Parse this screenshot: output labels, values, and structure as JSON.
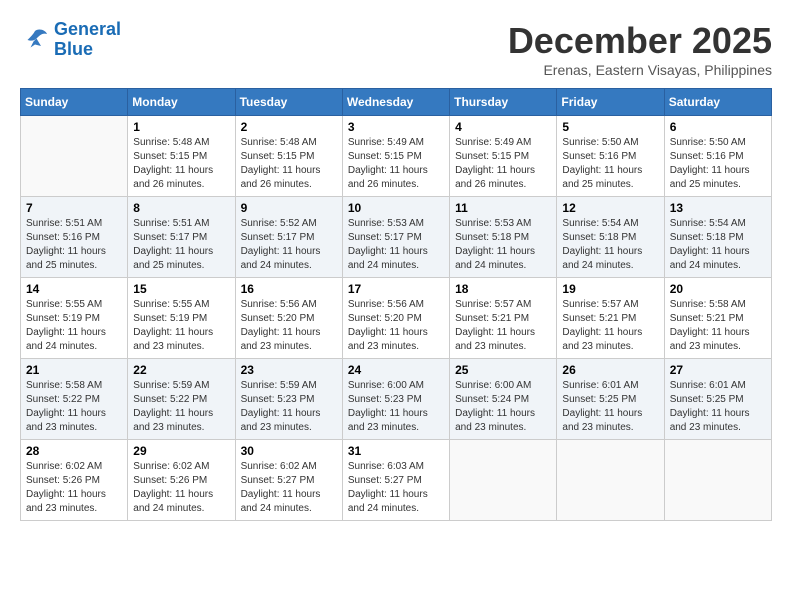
{
  "header": {
    "logo_line1": "General",
    "logo_line2": "Blue",
    "month": "December 2025",
    "location": "Erenas, Eastern Visayas, Philippines"
  },
  "days_of_week": [
    "Sunday",
    "Monday",
    "Tuesday",
    "Wednesday",
    "Thursday",
    "Friday",
    "Saturday"
  ],
  "weeks": [
    [
      {
        "day": "",
        "sunrise": "",
        "sunset": "",
        "daylight": "",
        "empty": true
      },
      {
        "day": "1",
        "sunrise": "Sunrise: 5:48 AM",
        "sunset": "Sunset: 5:15 PM",
        "daylight": "Daylight: 11 hours and 26 minutes."
      },
      {
        "day": "2",
        "sunrise": "Sunrise: 5:48 AM",
        "sunset": "Sunset: 5:15 PM",
        "daylight": "Daylight: 11 hours and 26 minutes."
      },
      {
        "day": "3",
        "sunrise": "Sunrise: 5:49 AM",
        "sunset": "Sunset: 5:15 PM",
        "daylight": "Daylight: 11 hours and 26 minutes."
      },
      {
        "day": "4",
        "sunrise": "Sunrise: 5:49 AM",
        "sunset": "Sunset: 5:15 PM",
        "daylight": "Daylight: 11 hours and 26 minutes."
      },
      {
        "day": "5",
        "sunrise": "Sunrise: 5:50 AM",
        "sunset": "Sunset: 5:16 PM",
        "daylight": "Daylight: 11 hours and 25 minutes."
      },
      {
        "day": "6",
        "sunrise": "Sunrise: 5:50 AM",
        "sunset": "Sunset: 5:16 PM",
        "daylight": "Daylight: 11 hours and 25 minutes."
      }
    ],
    [
      {
        "day": "7",
        "sunrise": "Sunrise: 5:51 AM",
        "sunset": "Sunset: 5:16 PM",
        "daylight": "Daylight: 11 hours and 25 minutes."
      },
      {
        "day": "8",
        "sunrise": "Sunrise: 5:51 AM",
        "sunset": "Sunset: 5:17 PM",
        "daylight": "Daylight: 11 hours and 25 minutes."
      },
      {
        "day": "9",
        "sunrise": "Sunrise: 5:52 AM",
        "sunset": "Sunset: 5:17 PM",
        "daylight": "Daylight: 11 hours and 24 minutes."
      },
      {
        "day": "10",
        "sunrise": "Sunrise: 5:53 AM",
        "sunset": "Sunset: 5:17 PM",
        "daylight": "Daylight: 11 hours and 24 minutes."
      },
      {
        "day": "11",
        "sunrise": "Sunrise: 5:53 AM",
        "sunset": "Sunset: 5:18 PM",
        "daylight": "Daylight: 11 hours and 24 minutes."
      },
      {
        "day": "12",
        "sunrise": "Sunrise: 5:54 AM",
        "sunset": "Sunset: 5:18 PM",
        "daylight": "Daylight: 11 hours and 24 minutes."
      },
      {
        "day": "13",
        "sunrise": "Sunrise: 5:54 AM",
        "sunset": "Sunset: 5:18 PM",
        "daylight": "Daylight: 11 hours and 24 minutes."
      }
    ],
    [
      {
        "day": "14",
        "sunrise": "Sunrise: 5:55 AM",
        "sunset": "Sunset: 5:19 PM",
        "daylight": "Daylight: 11 hours and 24 minutes."
      },
      {
        "day": "15",
        "sunrise": "Sunrise: 5:55 AM",
        "sunset": "Sunset: 5:19 PM",
        "daylight": "Daylight: 11 hours and 23 minutes."
      },
      {
        "day": "16",
        "sunrise": "Sunrise: 5:56 AM",
        "sunset": "Sunset: 5:20 PM",
        "daylight": "Daylight: 11 hours and 23 minutes."
      },
      {
        "day": "17",
        "sunrise": "Sunrise: 5:56 AM",
        "sunset": "Sunset: 5:20 PM",
        "daylight": "Daylight: 11 hours and 23 minutes."
      },
      {
        "day": "18",
        "sunrise": "Sunrise: 5:57 AM",
        "sunset": "Sunset: 5:21 PM",
        "daylight": "Daylight: 11 hours and 23 minutes."
      },
      {
        "day": "19",
        "sunrise": "Sunrise: 5:57 AM",
        "sunset": "Sunset: 5:21 PM",
        "daylight": "Daylight: 11 hours and 23 minutes."
      },
      {
        "day": "20",
        "sunrise": "Sunrise: 5:58 AM",
        "sunset": "Sunset: 5:21 PM",
        "daylight": "Daylight: 11 hours and 23 minutes."
      }
    ],
    [
      {
        "day": "21",
        "sunrise": "Sunrise: 5:58 AM",
        "sunset": "Sunset: 5:22 PM",
        "daylight": "Daylight: 11 hours and 23 minutes."
      },
      {
        "day": "22",
        "sunrise": "Sunrise: 5:59 AM",
        "sunset": "Sunset: 5:22 PM",
        "daylight": "Daylight: 11 hours and 23 minutes."
      },
      {
        "day": "23",
        "sunrise": "Sunrise: 5:59 AM",
        "sunset": "Sunset: 5:23 PM",
        "daylight": "Daylight: 11 hours and 23 minutes."
      },
      {
        "day": "24",
        "sunrise": "Sunrise: 6:00 AM",
        "sunset": "Sunset: 5:23 PM",
        "daylight": "Daylight: 11 hours and 23 minutes."
      },
      {
        "day": "25",
        "sunrise": "Sunrise: 6:00 AM",
        "sunset": "Sunset: 5:24 PM",
        "daylight": "Daylight: 11 hours and 23 minutes."
      },
      {
        "day": "26",
        "sunrise": "Sunrise: 6:01 AM",
        "sunset": "Sunset: 5:25 PM",
        "daylight": "Daylight: 11 hours and 23 minutes."
      },
      {
        "day": "27",
        "sunrise": "Sunrise: 6:01 AM",
        "sunset": "Sunset: 5:25 PM",
        "daylight": "Daylight: 11 hours and 23 minutes."
      }
    ],
    [
      {
        "day": "28",
        "sunrise": "Sunrise: 6:02 AM",
        "sunset": "Sunset: 5:26 PM",
        "daylight": "Daylight: 11 hours and 23 minutes."
      },
      {
        "day": "29",
        "sunrise": "Sunrise: 6:02 AM",
        "sunset": "Sunset: 5:26 PM",
        "daylight": "Daylight: 11 hours and 24 minutes."
      },
      {
        "day": "30",
        "sunrise": "Sunrise: 6:02 AM",
        "sunset": "Sunset: 5:27 PM",
        "daylight": "Daylight: 11 hours and 24 minutes."
      },
      {
        "day": "31",
        "sunrise": "Sunrise: 6:03 AM",
        "sunset": "Sunset: 5:27 PM",
        "daylight": "Daylight: 11 hours and 24 minutes."
      },
      {
        "day": "",
        "sunrise": "",
        "sunset": "",
        "daylight": "",
        "empty": true
      },
      {
        "day": "",
        "sunrise": "",
        "sunset": "",
        "daylight": "",
        "empty": true
      },
      {
        "day": "",
        "sunrise": "",
        "sunset": "",
        "daylight": "",
        "empty": true
      }
    ]
  ]
}
